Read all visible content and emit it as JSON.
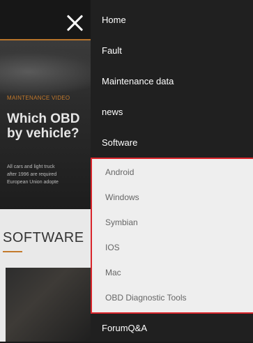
{
  "background": {
    "hero": {
      "kicker": "MAINTENANCE VIDEO",
      "title_lines": [
        "Which OBD",
        "by vehicle?"
      ],
      "body_lines": [
        "All cars and light truck",
        "after 1996 are required",
        "European Union adopte"
      ]
    },
    "section": {
      "title": "SOFTWARE"
    }
  },
  "drawer": {
    "close_icon": "close-icon",
    "items": [
      {
        "label": "Home"
      },
      {
        "label": "Fault"
      },
      {
        "label": "Maintenance data"
      },
      {
        "label": "news"
      },
      {
        "label": "Software"
      }
    ],
    "software_submenu": [
      {
        "label": "Android"
      },
      {
        "label": "Windows"
      },
      {
        "label": "Symbian"
      },
      {
        "label": "IOS"
      },
      {
        "label": "Mac"
      },
      {
        "label": "OBD Diagnostic Tools"
      }
    ],
    "after_items": [
      {
        "label": "ForumQ&A"
      }
    ]
  },
  "colors": {
    "drawer_bg": "#202020",
    "submenu_bg": "#eeeeee",
    "highlight_border": "#d9252b",
    "accent": "#c47a2c"
  }
}
